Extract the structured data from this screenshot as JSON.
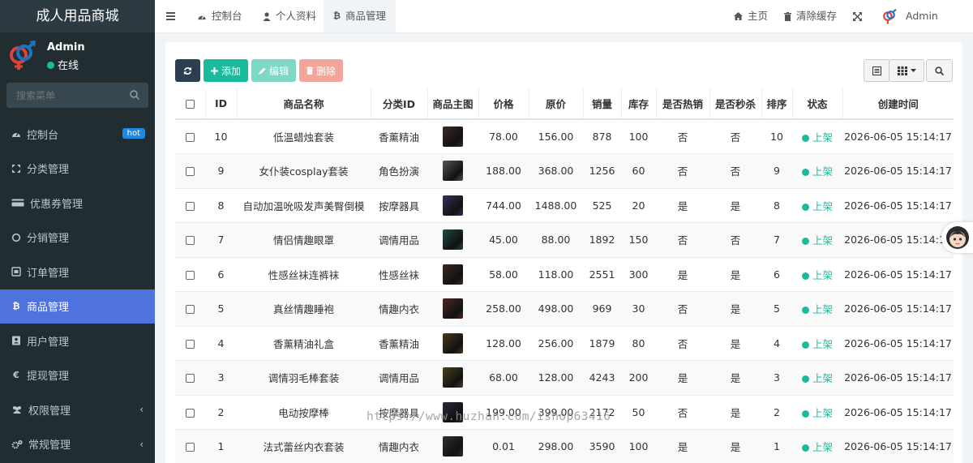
{
  "app": {
    "title": "成人用品商城"
  },
  "user": {
    "name": "Admin",
    "status": "在线"
  },
  "sidebar": {
    "search_placeholder": "搜索菜单",
    "items": [
      {
        "label": "控制台",
        "icon": "dashboard-icon",
        "badge": "hot"
      },
      {
        "label": "分类管理",
        "icon": "category-icon"
      },
      {
        "label": "优惠券管理",
        "icon": "credit-card-icon"
      },
      {
        "label": "分销管理",
        "icon": "circle-icon"
      },
      {
        "label": "订单管理",
        "icon": "order-icon"
      },
      {
        "label": "商品管理",
        "icon": "bitcoin-icon",
        "active": true
      },
      {
        "label": "用户管理",
        "icon": "user-card-icon"
      },
      {
        "label": "提现管理",
        "icon": "euro-icon"
      },
      {
        "label": "权限管理",
        "icon": "group-icon",
        "arrow": "‹"
      },
      {
        "label": "常规管理",
        "icon": "cogs-icon",
        "arrow": "‹"
      }
    ]
  },
  "topnav": {
    "tabs": [
      {
        "label": "控制台",
        "icon": "dashboard-icon"
      },
      {
        "label": "个人资料",
        "icon": "user-icon"
      },
      {
        "label": "商品管理",
        "icon": "bitcoin-icon",
        "active": true
      }
    ],
    "right": {
      "home": "主页",
      "clear_cache": "清除缓存",
      "admin": "Admin"
    }
  },
  "toolbar": {
    "add": "添加",
    "edit": "编辑",
    "delete": "删除"
  },
  "table": {
    "headers": [
      "ID",
      "商品名称",
      "分类ID",
      "商品主图",
      "价格",
      "原价",
      "销量",
      "库存",
      "是否热销",
      "是否秒杀",
      "排序",
      "状态",
      "创建时间"
    ],
    "rows": [
      {
        "id": "10",
        "name": "低温蜡烛套装",
        "cat": "香薰精油",
        "thumb": "#3a2a22",
        "price": "78.00",
        "orig": "156.00",
        "sales": "878",
        "stock": "100",
        "hot": "否",
        "seckill": "否",
        "sort": "10",
        "status": "上架",
        "created": "2026-06-05 15:14:17"
      },
      {
        "id": "9",
        "name": "女仆装cosplay套装",
        "cat": "角色扮演",
        "thumb": "#555559",
        "price": "188.00",
        "orig": "368.00",
        "sales": "1256",
        "stock": "60",
        "hot": "否",
        "seckill": "否",
        "sort": "9",
        "status": "上架",
        "created": "2026-06-05 15:14:17"
      },
      {
        "id": "8",
        "name": "自动加温吮吸发声美臀倒模",
        "cat": "按摩器具",
        "thumb": "#3a2f5a",
        "price": "744.00",
        "orig": "1488.00",
        "sales": "525",
        "stock": "20",
        "hot": "是",
        "seckill": "是",
        "sort": "8",
        "status": "上架",
        "created": "2026-06-05 15:14:17"
      },
      {
        "id": "7",
        "name": "情侣情趣眼罩",
        "cat": "调情用品",
        "thumb": "#1f4a44",
        "price": "45.00",
        "orig": "88.00",
        "sales": "1892",
        "stock": "150",
        "hot": "否",
        "seckill": "否",
        "sort": "7",
        "status": "上架",
        "created": "2026-06-05 15:14:17"
      },
      {
        "id": "6",
        "name": "性感丝袜连裤袜",
        "cat": "性感丝袜",
        "thumb": "#3b2820",
        "price": "58.00",
        "orig": "118.00",
        "sales": "2551",
        "stock": "300",
        "hot": "是",
        "seckill": "是",
        "sort": "6",
        "status": "上架",
        "created": "2026-06-05 15:14:17"
      },
      {
        "id": "5",
        "name": "真丝情趣睡袍",
        "cat": "情趣内衣",
        "thumb": "#4a2a22",
        "price": "258.00",
        "orig": "498.00",
        "sales": "969",
        "stock": "30",
        "hot": "否",
        "seckill": "是",
        "sort": "5",
        "status": "上架",
        "created": "2026-06-05 15:14:17"
      },
      {
        "id": "4",
        "name": "香薰精油礼盒",
        "cat": "香薰精油",
        "thumb": "#4d3a18",
        "price": "128.00",
        "orig": "256.00",
        "sales": "1879",
        "stock": "80",
        "hot": "否",
        "seckill": "是",
        "sort": "4",
        "status": "上架",
        "created": "2026-06-05 15:14:17"
      },
      {
        "id": "3",
        "name": "调情羽毛棒套装",
        "cat": "调情用品",
        "thumb": "#4a4020",
        "price": "68.00",
        "orig": "128.00",
        "sales": "4243",
        "stock": "200",
        "hot": "是",
        "seckill": "是",
        "sort": "3",
        "status": "上架",
        "created": "2026-06-05 15:14:17"
      },
      {
        "id": "2",
        "name": "电动按摩棒",
        "cat": "按摩器具",
        "thumb": "#2a2a3a",
        "price": "199.00",
        "orig": "399.00",
        "sales": "2172",
        "stock": "50",
        "hot": "否",
        "seckill": "是",
        "sort": "2",
        "status": "上架",
        "created": "2026-06-05 15:14:17"
      },
      {
        "id": "1",
        "name": "法式蕾丝内衣套装",
        "cat": "情趣内衣",
        "thumb": "#2f2f2f",
        "price": "0.01",
        "orig": "298.00",
        "sales": "3590",
        "stock": "100",
        "hot": "是",
        "seckill": "是",
        "sort": "1",
        "status": "上架",
        "created": "2026-06-05 15:14:17"
      }
    ]
  },
  "watermark": "https://www.huzhan.com/ishop63416",
  "colors": {
    "sidebar_bg": "#222d32",
    "active_blue": "#4e73df",
    "success": "#18bc9c",
    "add_btn": "#18bc9c",
    "edit_btn": "#7fd8c6",
    "delete_btn": "#f4a59b",
    "refresh_btn": "#2c3e50"
  }
}
